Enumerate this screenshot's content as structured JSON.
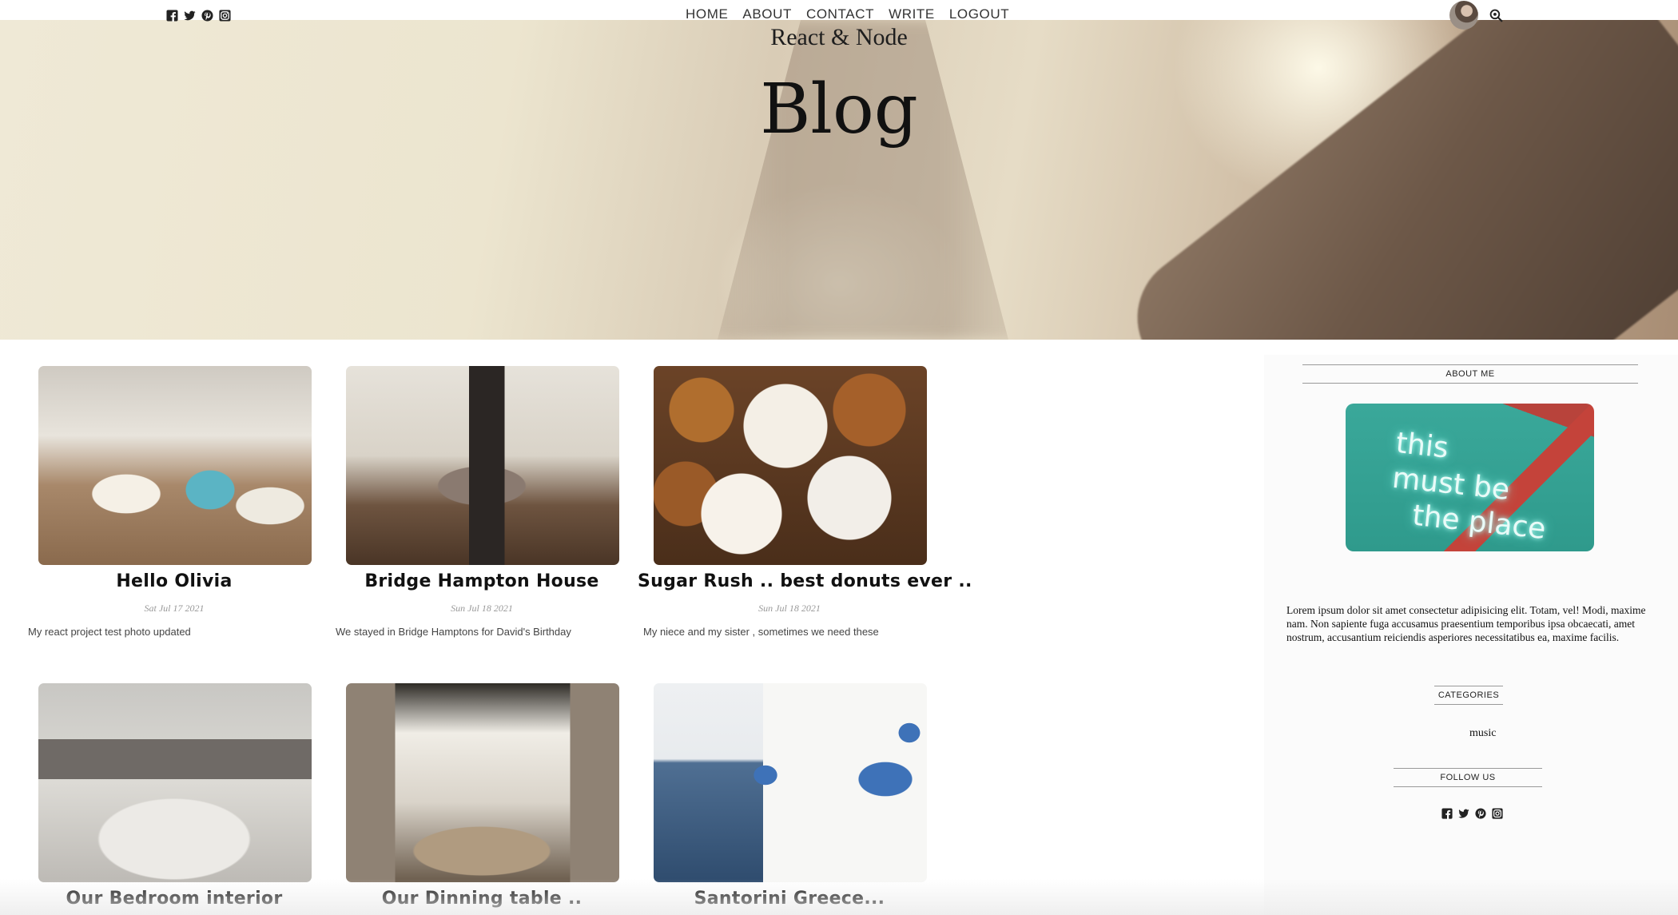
{
  "header": {
    "social_icons": [
      "facebook-square",
      "twitter",
      "pinterest",
      "instagram"
    ],
    "nav": [
      "HOME",
      "ABOUT",
      "CONTACT",
      "WRITE",
      "LOGOUT"
    ]
  },
  "hero": {
    "subtitle": "React & Node",
    "title": "Blog"
  },
  "posts": [
    {
      "title": "Hello Olivia",
      "date": "Sat Jul 17 2021",
      "desc": "My react project test photo updated"
    },
    {
      "title": "Bridge Hampton House",
      "date": "Sun Jul 18 2021",
      "desc": "We stayed in Bridge Hamptons for David's Birthday"
    },
    {
      "title": "Sugar Rush .. best donuts ever ..",
      "date": "Sun Jul 18 2021",
      "desc": "My niece and my sister , sometimes we need these"
    },
    {
      "title": "Our Bedroom interior"
    },
    {
      "title": "Our Dinning table .."
    },
    {
      "title": "Santorini Greece..."
    }
  ],
  "sidebar": {
    "about_title": "ABOUT ME",
    "image_text": [
      "this",
      "must be",
      "the place"
    ],
    "about_text": "Lorem ipsum dolor sit amet consectetur adipisicing elit. Totam, vel! Modi, maxime nam. Non sapiente fuga accusamus praesentium temporibus ipsa obcaecati, amet nostrum, accusantium reiciendis asperiores necessitatibus ea, maxime facilis.",
    "categories_title": "CATEGORIES",
    "categories": [
      "music"
    ],
    "follow_title": "FOLLOW US"
  }
}
